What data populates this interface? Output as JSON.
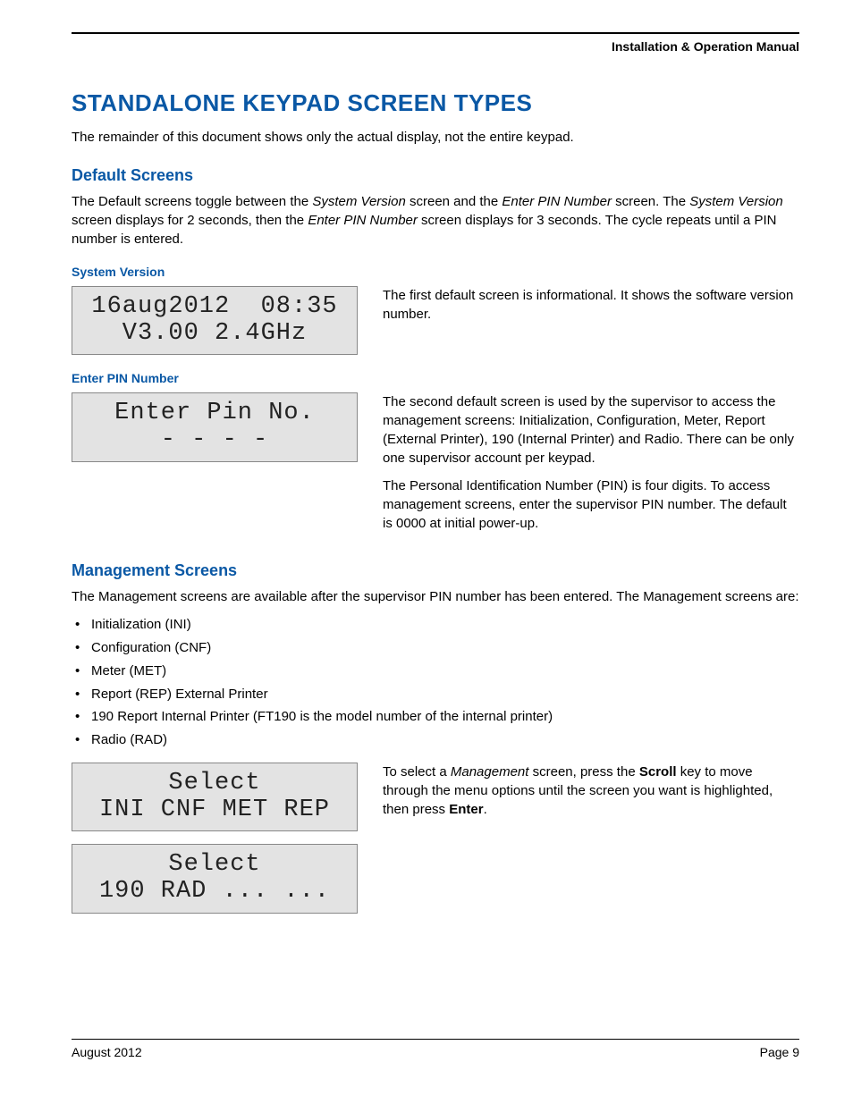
{
  "header": {
    "title": "Installation & Operation Manual"
  },
  "h1": "STANDALONE KEYPAD SCREEN TYPES",
  "intro": "The remainder of this document shows only the actual display, not the entire keypad.",
  "default_screens": {
    "heading": "Default Screens",
    "para_a": "The Default screens toggle between the ",
    "para_b": "System Version",
    "para_c": " screen and the ",
    "para_d": "Enter PIN Number",
    "para_e": " screen. The ",
    "para_f": "System Version",
    "para_g": " screen displays for 2 seconds, then the ",
    "para_h": "Enter PIN Number",
    "para_i": " screen displays for 3 seconds. The cycle repeats until a PIN number is entered."
  },
  "sys_version": {
    "heading": "System Version",
    "lcd_line1": "16aug2012  08:35",
    "lcd_line2": "V3.00 2.4GHz",
    "desc": "The first default screen is informational. It shows the software version number."
  },
  "enter_pin": {
    "heading": "Enter PIN Number",
    "lcd_line1": "Enter Pin No.",
    "lcd_line2": "- - - -",
    "desc1": "The second default screen is used by the supervisor to access the management screens: Initialization, Configuration, Meter, Report (External Printer), 190 (Internal Printer) and Radio. There can be only one supervisor account per keypad.",
    "desc2": "The Personal Identification Number (PIN) is four digits. To access management screens, enter the supervisor PIN number. The default is 0000 at initial power-up."
  },
  "mgmt": {
    "heading": "Management Screens",
    "intro": "The Management screens are available after the supervisor PIN number has been entered. The Management screens are:",
    "items": [
      "Initialization (INI)",
      "Configuration (CNF)",
      "Meter (MET)",
      "Report (REP) External Printer",
      "190 Report Internal Printer (FT190 is the model number of the internal printer)",
      "Radio (RAD)"
    ],
    "select1_line1": "Select",
    "select1_line2": "INI CNF MET REP",
    "select2_line1": "Select",
    "select2_line2": "190 RAD ... ...",
    "desc_a": "To select a ",
    "desc_b": "Management",
    "desc_c": " screen, press the ",
    "desc_d": "Scroll",
    "desc_e": " key to move through the menu options until the screen you want is highlighted, then press ",
    "desc_f": "Enter",
    "desc_g": "."
  },
  "footer": {
    "left": "August 2012",
    "right": "Page 9"
  }
}
